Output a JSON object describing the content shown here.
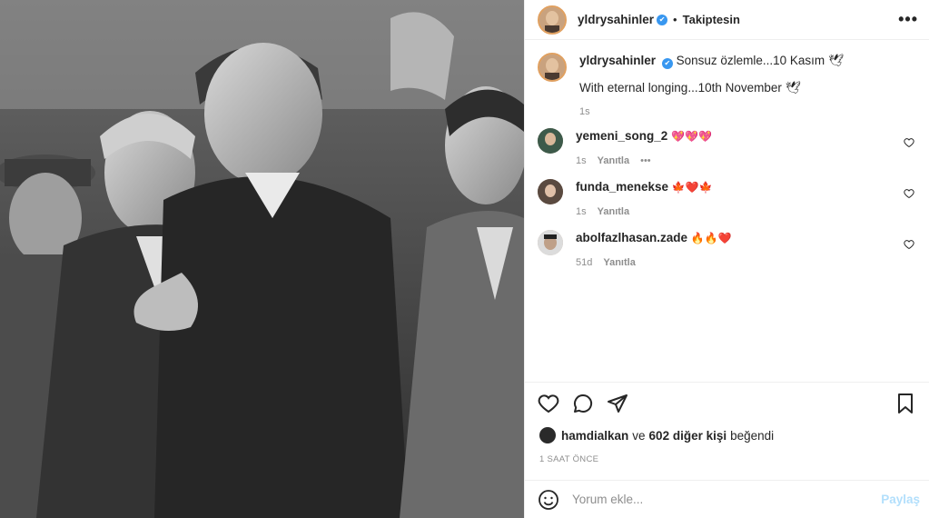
{
  "post": {
    "author": "yldrysahinler",
    "verified_mark": "✔",
    "separator": "•",
    "follow_status": "Takiptesin",
    "more": "•••"
  },
  "caption": {
    "username": "yldrysahinler",
    "text": "Sonsuz özlemle...10 Kasım 🕊",
    "text_en": "With eternal longing...10th November 🕊",
    "time": "1s"
  },
  "comments": [
    {
      "username": "yemeni_song_2",
      "text": "💖💖💖",
      "time": "1s",
      "reply": "Yanıtla",
      "more": "•••"
    },
    {
      "username": "funda_menekse",
      "text": "🍁❤️🍁",
      "time": "1s",
      "reply": "Yanıtla"
    },
    {
      "username": "abolfazlhasan.zade",
      "text": "🔥🔥❤️",
      "time": "51d",
      "reply": "Yanıtla"
    }
  ],
  "likes": {
    "user": "hamdialkan",
    "connector": "ve",
    "others": "602 diğer kişi",
    "suffix": "beğendi"
  },
  "posted_ago": "1 SAAT ÖNCE",
  "add_comment": {
    "placeholder": "Yorum ekle...",
    "post_label": "Paylaş"
  },
  "icons": [
    "heart-icon",
    "comment-icon",
    "share-icon",
    "bookmark-icon",
    "emoji-icon"
  ]
}
